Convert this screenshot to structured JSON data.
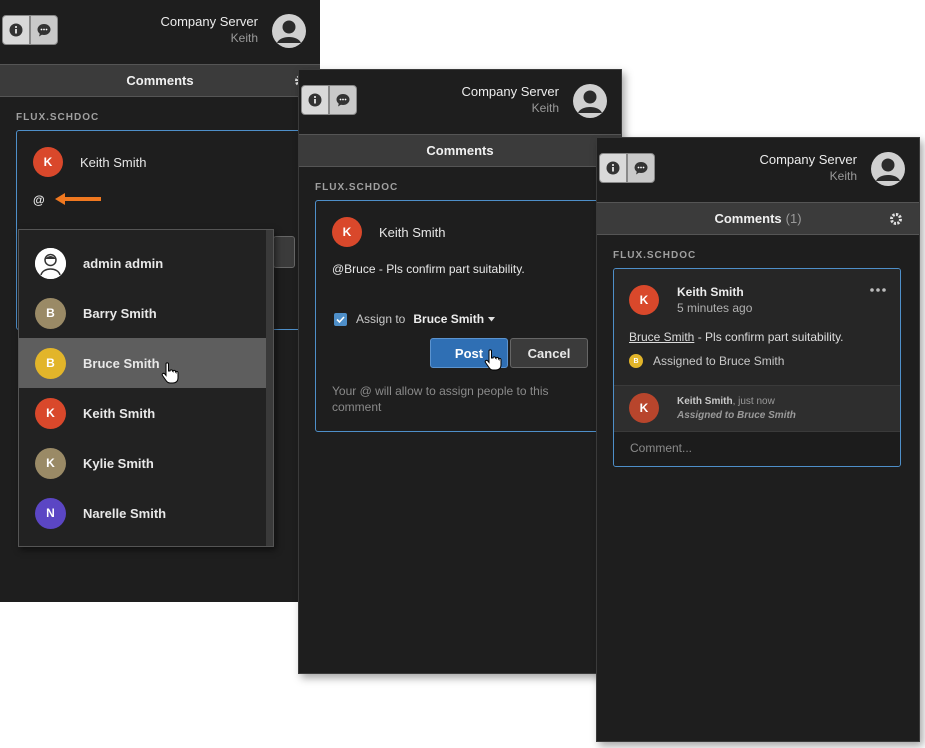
{
  "header": {
    "server_name": "Company Server",
    "user_name": "Keith"
  },
  "panel_title": "Comments",
  "comment_count": "(1)",
  "doc_label": "FLUX.SCHDOC",
  "panel1": {
    "author": "Keith Smith",
    "author_initial": "K",
    "typed_text": "@",
    "mention_list": [
      {
        "name": "admin admin",
        "initial": "",
        "color": "#ffffff",
        "icon": "person-outline-icon"
      },
      {
        "name": "Barry Smith",
        "initial": "B",
        "color": "#9a8a66"
      },
      {
        "name": "Bruce Smith",
        "initial": "B",
        "color": "#e2b52a",
        "selected": true
      },
      {
        "name": "Keith Smith",
        "initial": "K",
        "color": "#d9482b"
      },
      {
        "name": "Kylie Smith",
        "initial": "K",
        "color": "#9a8a66"
      },
      {
        "name": "Narelle Smith",
        "initial": "N",
        "color": "#5b46c4"
      }
    ]
  },
  "panel2": {
    "author": "Keith Smith",
    "author_initial": "K",
    "comment_text": "@Bruce - Pls confirm part suitability.",
    "assign_label": "Assign to",
    "assignee": "Bruce Smith",
    "post_label": "Post",
    "cancel_label": "Cancel",
    "hint": "Your @ will allow to assign people to this comment"
  },
  "panel3": {
    "author": "Keith Smith",
    "author_initial": "K",
    "time": "5 minutes ago",
    "mention": "Bruce Smith",
    "comment_rest": " - Pls confirm part suitability.",
    "assigned_initial": "B",
    "assigned_text": "Assigned to Bruce Smith",
    "reply_author": "Keith Smith",
    "reply_time": ", just now",
    "reply_text": "Assigned to Bruce Smith",
    "reply_placeholder": "Comment..."
  },
  "colors": {
    "accent_blue": "#4e8fc9",
    "keith_avatar": "#d9482b",
    "bruce_avatar": "#e2b52a",
    "arrow": "#f07820"
  }
}
